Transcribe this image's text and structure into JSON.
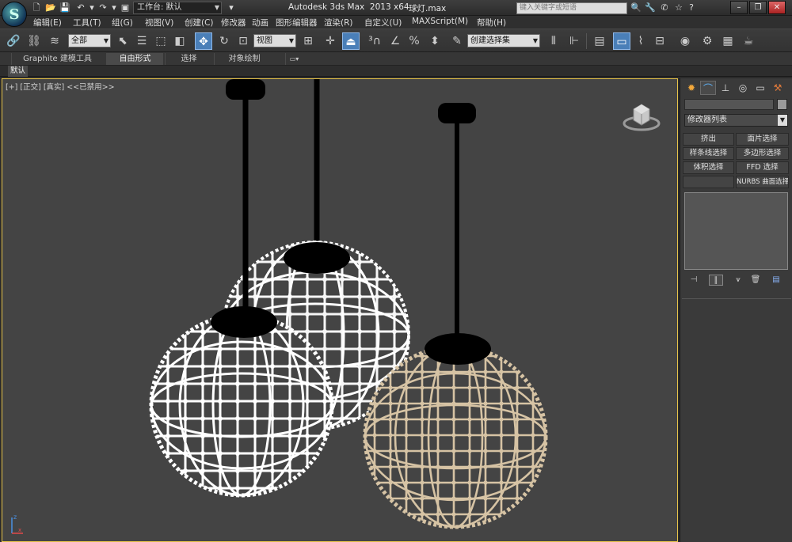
{
  "titlebar": {
    "logo": "S",
    "workspace_label": "工作台: 默认",
    "app_title": "Autodesk 3ds Max  2013 x64",
    "file_title": "球灯.max",
    "search_placeholder": "键入关键字或短语",
    "window_minimize": "–",
    "window_restore": "❐",
    "window_close": "✕"
  },
  "menu": {
    "items": [
      "编辑(E)",
      "工具(T)",
      "组(G)",
      "视图(V)",
      "创建(C)",
      "修改器",
      "动画",
      "图形编辑器",
      "渲染(R)",
      "自定义(U)",
      "MAXScript(M)",
      "帮助(H)"
    ]
  },
  "toolbar": {
    "selection_filter": "全部",
    "ref_coord": "视图",
    "named_selection_set": "创建选择集"
  },
  "ribbon": {
    "tabs": [
      "Graphite 建模工具",
      "自由形式",
      "选择",
      "对象绘制"
    ],
    "active_tab": "自由形式",
    "default_label": "默认"
  },
  "viewport": {
    "label": "[+] [正交] [真实]  <<已禁用>>",
    "axis_z": "z",
    "axis_x": "x",
    "border_color": "#e6c34a",
    "background_color": "#444444",
    "lamp_colors": {
      "white_wire": "#ffffff",
      "beige_wire": "#d6c3a4",
      "shade": "#000000"
    }
  },
  "command_panel": {
    "modifier_list": "修改器列表",
    "buttons": [
      {
        "label": "挤出"
      },
      {
        "label": "面片选择"
      },
      {
        "label": "样条线选择"
      },
      {
        "label": "多边形选择"
      },
      {
        "label": "体积选择"
      },
      {
        "label": "FFD 选择"
      },
      {
        "label": ""
      },
      {
        "label": "NURBS 曲面选择"
      }
    ]
  }
}
